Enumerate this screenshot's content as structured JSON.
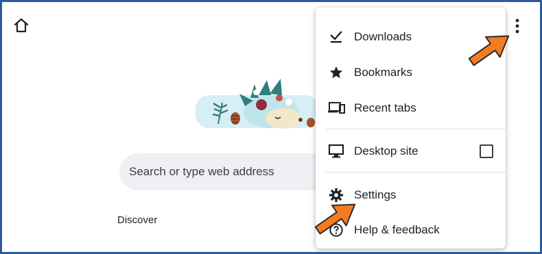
{
  "toolbar": {
    "home_icon": "home-icon",
    "more_icon": "more-vert-icon"
  },
  "ntp": {
    "search_placeholder": "Search or type web address",
    "discover_label": "Discover"
  },
  "menu": {
    "items": [
      {
        "label": "Downloads",
        "icon": "download-done-icon"
      },
      {
        "label": "Bookmarks",
        "icon": "star-icon"
      },
      {
        "label": "Recent tabs",
        "icon": "devices-icon"
      },
      {
        "label": "Desktop site",
        "icon": "monitor-icon",
        "checkbox_checked": false
      },
      {
        "label": "Settings",
        "icon": "gear-icon"
      },
      {
        "label": "Help & feedback",
        "icon": "help-icon"
      }
    ]
  },
  "colors": {
    "frame_border": "#2d5a9e",
    "arrow_fill": "#f47b20",
    "arrow_stroke": "#2b2b2b"
  }
}
